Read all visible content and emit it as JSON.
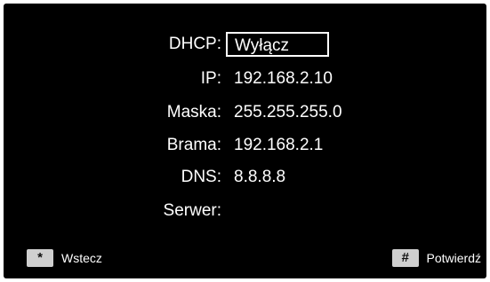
{
  "network": {
    "dhcp": {
      "label": "DHCP:",
      "value": "Wyłącz"
    },
    "ip": {
      "label": "IP:",
      "value": "192.168.2.10"
    },
    "mask": {
      "label": "Maska:",
      "value": "255.255.255.0"
    },
    "gateway": {
      "label": "Brama:",
      "value": "192.168.2.1"
    },
    "dns": {
      "label": "DNS:",
      "value": "8.8.8.8"
    },
    "server": {
      "label": "Serwer:",
      "value": ""
    }
  },
  "footer": {
    "back_key": "*",
    "back_label": "Wstecz",
    "confirm_key": "#",
    "confirm_label": "Potwierdź"
  }
}
